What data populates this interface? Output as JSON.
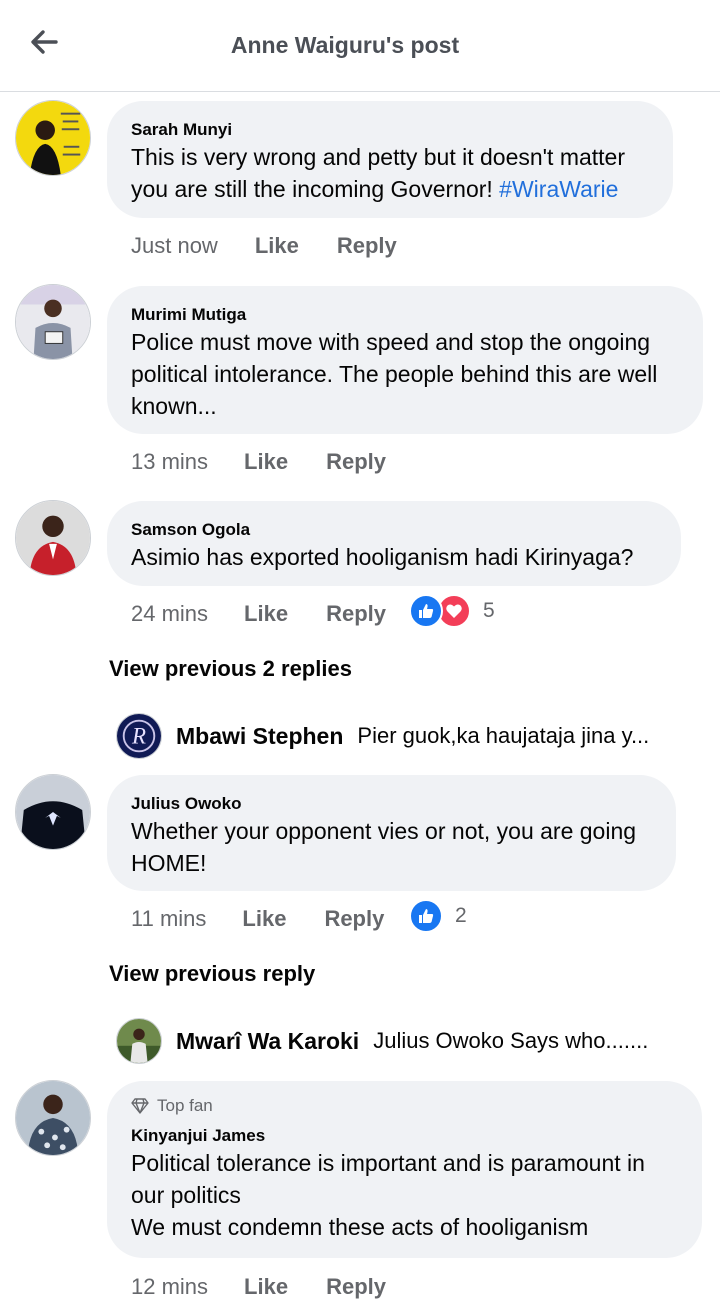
{
  "header": {
    "title": "Anne Waiguru's post",
    "back_icon": "arrow-left-icon"
  },
  "comments": [
    {
      "author": "Sarah Munyi",
      "text_plain": "This is very wrong and petty but it doesn't matter you are still the incoming Governor!",
      "hashtag": "#WiraWarie",
      "time": "Just now",
      "like": "Like",
      "reply": "Reply"
    },
    {
      "author": "Murimi Mutiga",
      "text": "Police must move with speed and stop the ongoing political intolerance. The people behind this are well known...",
      "time": "13 mins",
      "like": "Like",
      "reply": "Reply"
    },
    {
      "author": "Samson Ogola",
      "text": "Asimio has exported hooliganism hadi Kirinyaga?",
      "time": "24 mins",
      "like": "Like",
      "reply": "Reply",
      "reactions": {
        "count": "5",
        "icons": [
          "like-reaction-icon",
          "love-reaction-icon"
        ]
      },
      "view_previous": "View previous 2 replies",
      "latest_reply": {
        "name": "Mbawi Stephen",
        "text": "Pier guok,ka haujataja jina y..."
      }
    },
    {
      "author": "Julius Owoko",
      "text": "Whether your opponent vies or not, you are going HOME!",
      "time": "11 mins",
      "like": "Like",
      "reply": "Reply",
      "reactions": {
        "count": "2",
        "icons": [
          "like-reaction-icon"
        ]
      },
      "view_previous": "View previous reply",
      "latest_reply": {
        "name": "Mwarî Wa Karoki",
        "text": "Julius Owoko Says who......."
      }
    },
    {
      "badge": "Top fan",
      "badge_icon": "diamond-icon",
      "author": "Kinyanjui James",
      "text_line1": "Political tolerance is important and is paramount in our politics",
      "text_line2": "We must condemn these acts of hooliganism",
      "time": "12 mins",
      "like": "Like",
      "reply": "Reply"
    }
  ],
  "colors": {
    "bubble": "#f0f2f5",
    "link": "#216fdb",
    "like_blue": "#1877f2",
    "love_red": "#f33e58",
    "muted": "#65676b"
  }
}
